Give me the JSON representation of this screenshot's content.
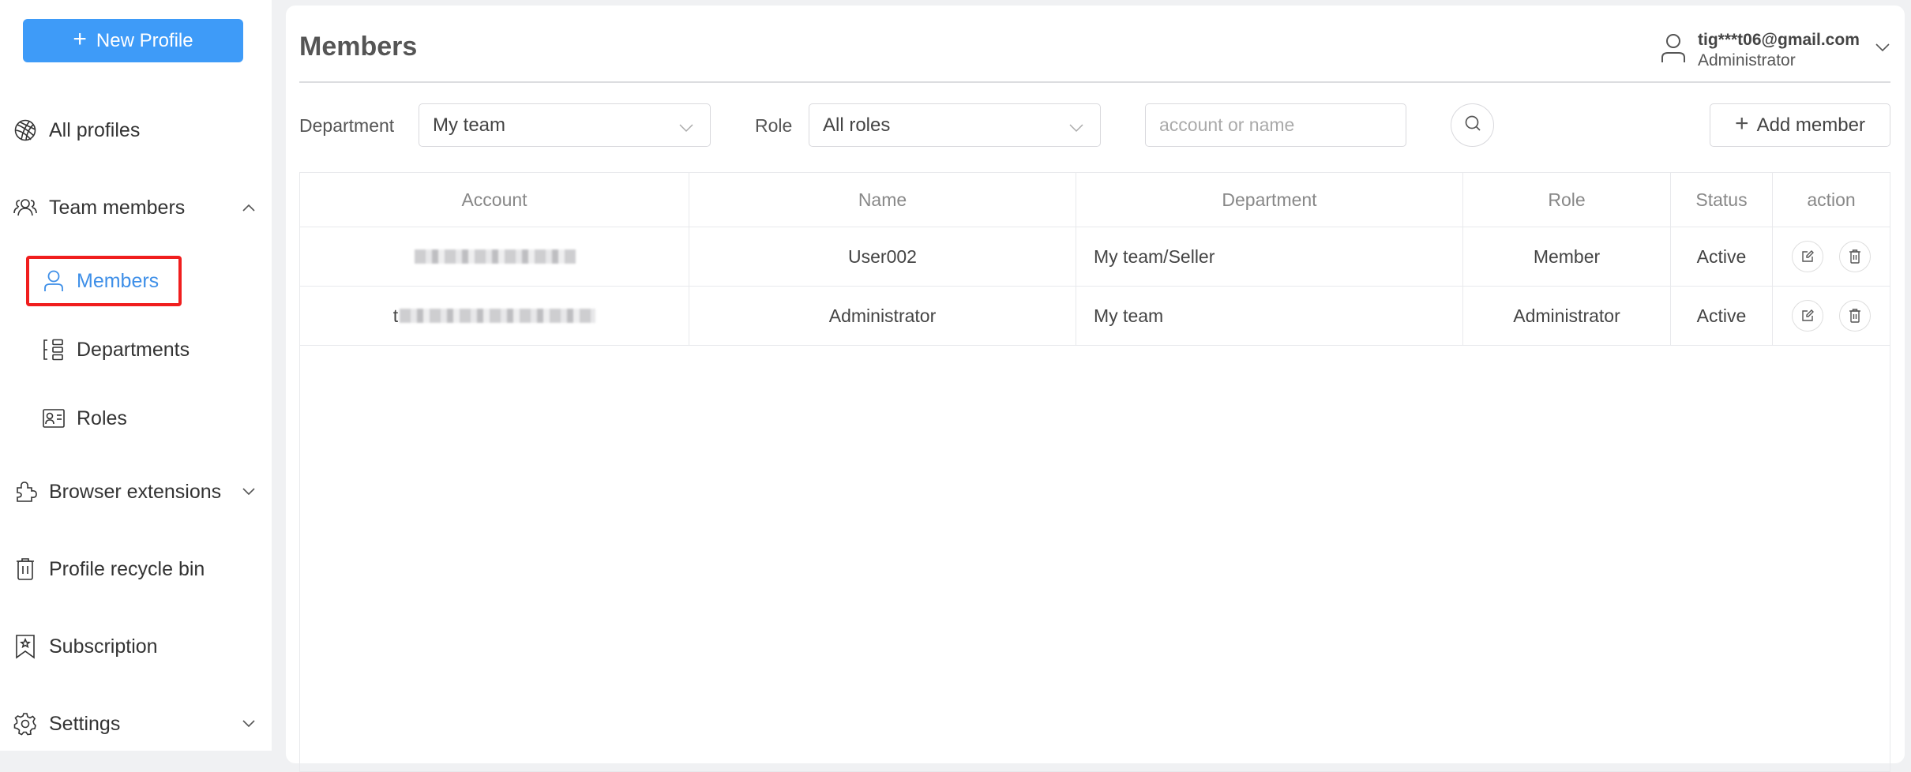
{
  "sidebar": {
    "new_profile_label": "New Profile",
    "items": [
      {
        "label": "All profiles",
        "icon": "globe-icon"
      },
      {
        "label": "Team members",
        "icon": "team-icon",
        "expanded": true
      },
      {
        "label": "Members",
        "icon": "user-icon",
        "active": true
      },
      {
        "label": "Departments",
        "icon": "departments-icon"
      },
      {
        "label": "Roles",
        "icon": "id-card-icon"
      },
      {
        "label": "Browser extensions",
        "icon": "puzzle-icon",
        "expanded": false
      },
      {
        "label": "Profile recycle bin",
        "icon": "trash-icon"
      },
      {
        "label": "Subscription",
        "icon": "bookmark-star-icon"
      },
      {
        "label": "Settings",
        "icon": "gear-icon",
        "expanded": false
      }
    ]
  },
  "header": {
    "title": "Members",
    "user": {
      "email": "tig***t06@gmail.com",
      "role": "Administrator"
    }
  },
  "filters": {
    "department_label": "Department",
    "department_value": "My team",
    "role_label": "Role",
    "role_value": "All roles",
    "search_placeholder": "account or name",
    "search_value": "",
    "add_member_label": "Add member"
  },
  "table": {
    "columns": [
      "Account",
      "Name",
      "Department",
      "Role",
      "Status",
      "action"
    ],
    "rows": [
      {
        "account": "",
        "account_prefix": "",
        "name": "User002",
        "department": "My team/Seller",
        "role": "Member",
        "status": "Active"
      },
      {
        "account": "",
        "account_prefix": "t",
        "name": "Administrator",
        "department": "My team",
        "role": "Administrator",
        "status": "Active"
      }
    ]
  },
  "colors": {
    "accent": "#3e9bf8",
    "active_nav": "#3e8fe8",
    "highlight": "#f01e1e"
  }
}
